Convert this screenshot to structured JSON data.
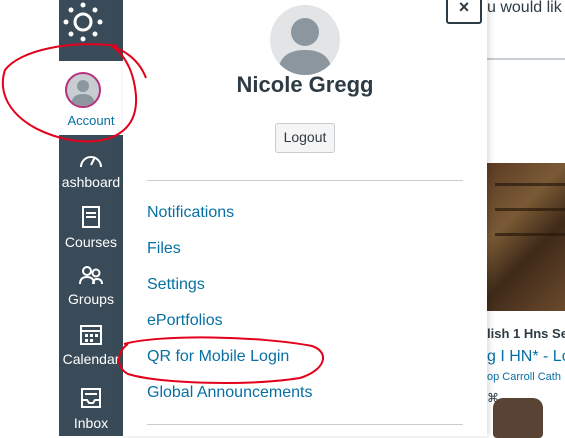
{
  "background_page": {
    "top_text": "u would lik",
    "card_label": "lish 1 Hns Se",
    "card_title": "g I HN* - Lo",
    "card_subtitle": "op Carroll Cath"
  },
  "nav": {
    "account_label": "Account",
    "dashboard_label": "ashboard",
    "courses_label": "Courses",
    "groups_label": "Groups",
    "calendar_label": "Calendar",
    "inbox_label": "Inbox"
  },
  "tray": {
    "close_label": "×",
    "user_name": "Nicole Gregg",
    "logout_label": "Logout",
    "links": [
      "Notifications",
      "Files",
      "Settings",
      "ePortfolios",
      "QR for Mobile Login",
      "Global Announcements"
    ]
  },
  "colors": {
    "nav_bg": "#394b58",
    "link": "#0770a3",
    "annotation": "#e3001b",
    "avatar_ring": "#b5317f"
  }
}
